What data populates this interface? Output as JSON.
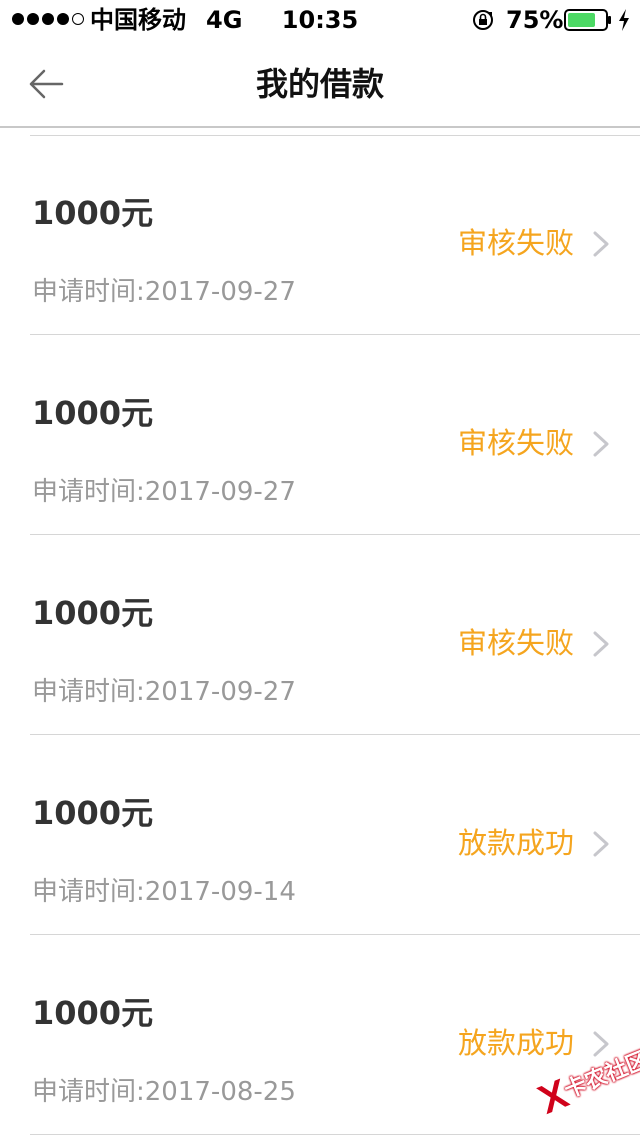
{
  "status_bar": {
    "carrier": "中国移动",
    "network": "4G",
    "time": "10:35",
    "battery_percent": "75%",
    "battery_level": 0.75,
    "battery_color": "#4cd964"
  },
  "nav": {
    "title": "我的借款",
    "back_icon": "arrow-left-icon"
  },
  "loans": [
    {
      "amount": "1000元",
      "time_label": "申请时间:",
      "date": "2017-09-27",
      "status": "审核失败"
    },
    {
      "amount": "1000元",
      "time_label": "申请时间:",
      "date": "2017-09-27",
      "status": "审核失败"
    },
    {
      "amount": "1000元",
      "time_label": "申请时间:",
      "date": "2017-09-27",
      "status": "审核失败"
    },
    {
      "amount": "1000元",
      "time_label": "申请时间:",
      "date": "2017-09-14",
      "status": "放款成功"
    },
    {
      "amount": "1000元",
      "time_label": "申请时间:",
      "date": "2017-08-25",
      "status": "放款成功"
    }
  ],
  "colors": {
    "status_accent": "#f5a51f",
    "amount_text": "#333333",
    "secondary_text": "#999999",
    "watermark": "#d0021b"
  },
  "watermark": {
    "text": "卡农社区"
  }
}
